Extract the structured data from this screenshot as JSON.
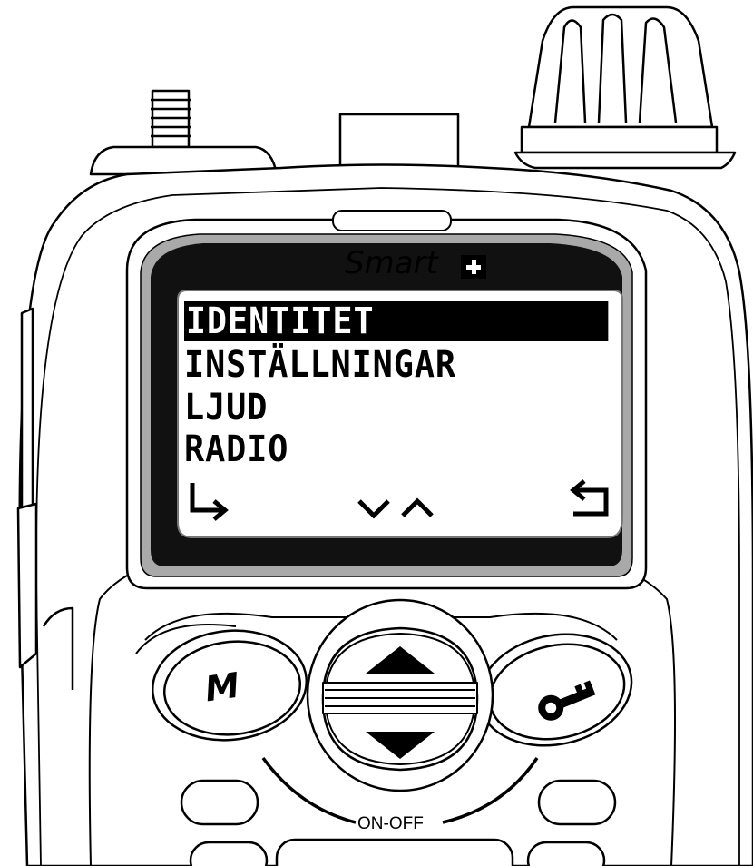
{
  "brand": {
    "name": "Smart"
  },
  "menu": {
    "items": [
      {
        "label": "IDENTITET",
        "selected": true
      },
      {
        "label": "INSTÄLLNINGAR",
        "selected": false
      },
      {
        "label": "LJUD",
        "selected": false
      },
      {
        "label": "RADIO",
        "selected": false
      }
    ]
  },
  "softkeys": {
    "left": "enter-arrow-icon",
    "center": "down-up-chevrons-icon",
    "right": "back-arrow-icon"
  },
  "buttons": {
    "m_label": "M",
    "key_icon": "key-icon",
    "up_icon": "up-triangle-icon",
    "down_icon": "down-triangle-icon",
    "power_label": "ON-OFF"
  },
  "colors": {
    "ink": "#000000",
    "body": "#ffffff",
    "bezel": "#111111",
    "bezel_rim": "#a9a9a9"
  }
}
